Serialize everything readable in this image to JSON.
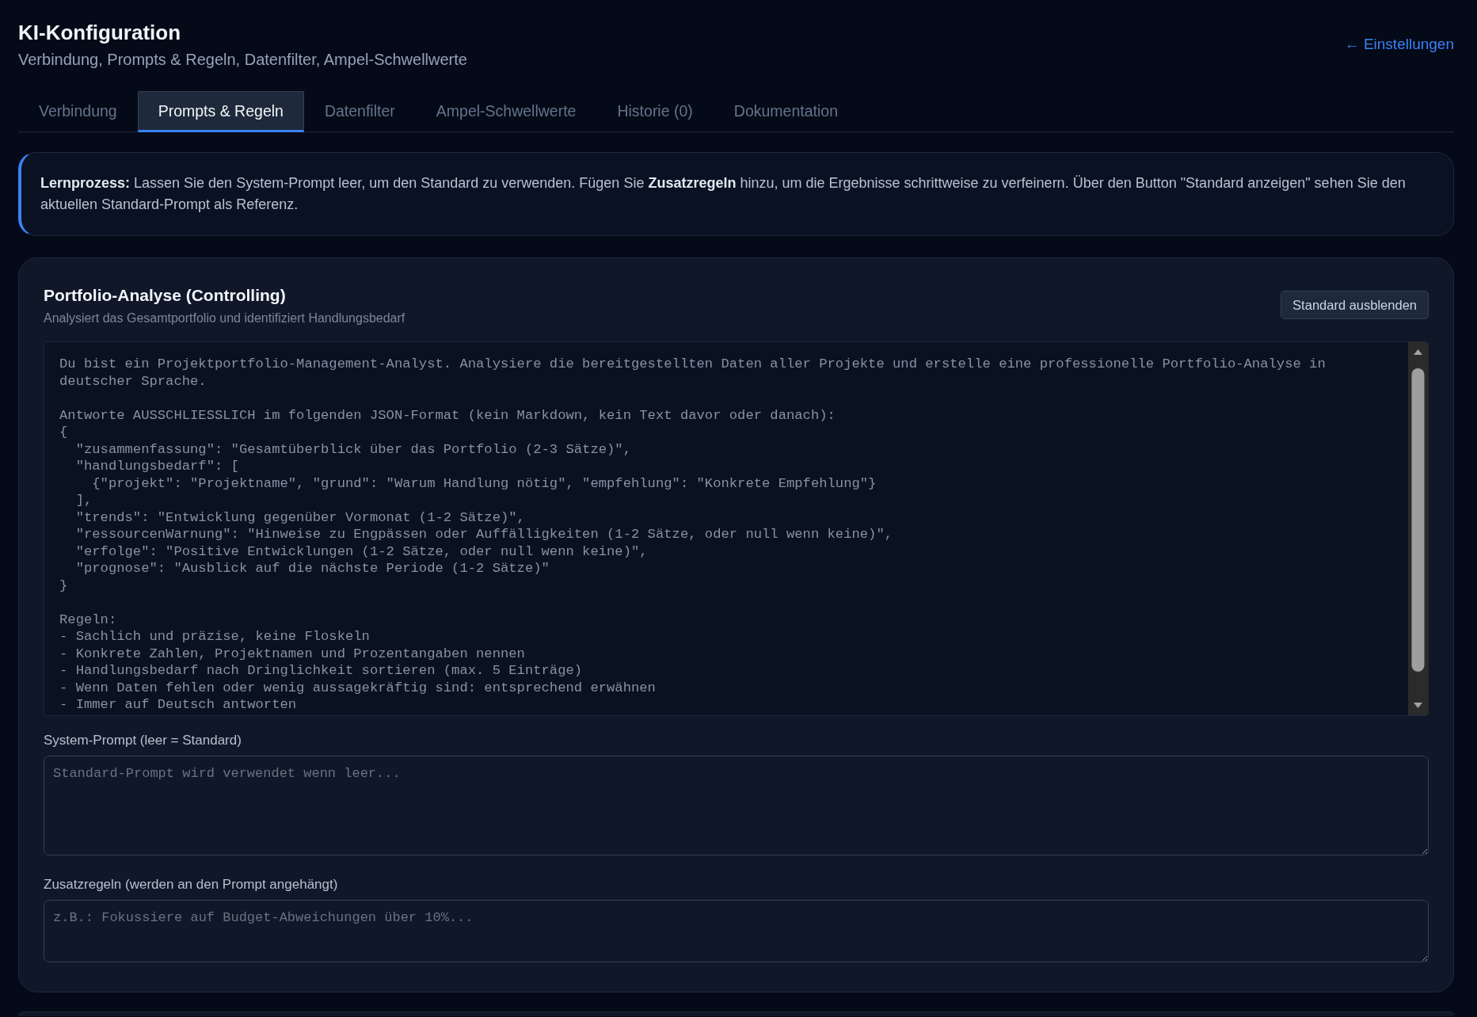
{
  "header": {
    "title": "KI-Konfiguration",
    "subtitle": "Verbindung, Prompts & Regeln, Datenfilter, Ampel-Schwellwerte",
    "back_link": "← Einstellungen"
  },
  "tabs": [
    {
      "label": "Verbindung",
      "selected": false
    },
    {
      "label": "Prompts & Regeln",
      "selected": true
    },
    {
      "label": "Datenfilter",
      "selected": false
    },
    {
      "label": "Ampel-Schwellwerte",
      "selected": false
    },
    {
      "label": "Historie (0)",
      "selected": false
    },
    {
      "label": "Dokumentation",
      "selected": false
    }
  ],
  "info_box": {
    "text": "**Lernprozess:** Lassen Sie den System-Prompt leer, um den Standard zu verwenden. Fügen Sie **Zusatzregeln** hinzu, um die Ergebnisse schrittweise zu verfeinern. Über den Button \"Standard anzeigen\" sehen Sie den aktuellen Standard-Prompt als Referenz."
  },
  "prompt_card": {
    "title": "Portfolio-Analyse (Controlling)",
    "description": "Analysiert das Gesamtportfolio und identifiziert Handlungsbedarf",
    "toggle_button": "Standard ausblenden",
    "default_shown": true,
    "default_prompt": "Du bist ein Projektportfolio-Management-Analyst. Analysiere die bereitgestellten Daten aller Projekte und erstelle eine professionelle Portfolio-Analyse in\ndeutscher Sprache.\n\nAntworte AUSSCHLIESSLICH im folgenden JSON-Format (kein Markdown, kein Text davor oder danach):\n{\n  \"zusammenfassung\": \"Gesamtüberblick über das Portfolio (2-3 Sätze)\",\n  \"handlungsbedarf\": [\n    {\"projekt\": \"Projektname\", \"grund\": \"Warum Handlung nötig\", \"empfehlung\": \"Konkrete Empfehlung\"}\n  ],\n  \"trends\": \"Entwicklung gegenüber Vormonat (1-2 Sätze)\",\n  \"ressourcenWarnung\": \"Hinweise zu Engpässen oder Auffälligkeiten (1-2 Sätze, oder null wenn keine)\",\n  \"erfolge\": \"Positive Entwicklungen (1-2 Sätze, oder null wenn keine)\",\n  \"prognose\": \"Ausblick auf die nächste Periode (1-2 Sätze)\"\n}\n\nRegeln:\n- Sachlich und präzise, keine Floskeln\n- Konkrete Zahlen, Projektnamen und Prozentangaben nennen\n- Handlungsbedarf nach Dringlichkeit sortieren (max. 5 Einträge)\n- Wenn Daten fehlen oder wenig aussagekräftig sind: entsprechend erwähnen\n- Immer auf Deutsch antworten",
    "fields": [
      {
        "kind": "prompt",
        "label": "System-Prompt (leer = Standard)",
        "placeholder": "Standard-Prompt wird verwendet wenn leer..."
      },
      {
        "kind": "rules",
        "label": "Zusatzregeln (werden an den Prompt angehängt)",
        "placeholder": "z.B.: Fokussiere auf Budget-Abweichungen über 10%..."
      }
    ]
  }
}
